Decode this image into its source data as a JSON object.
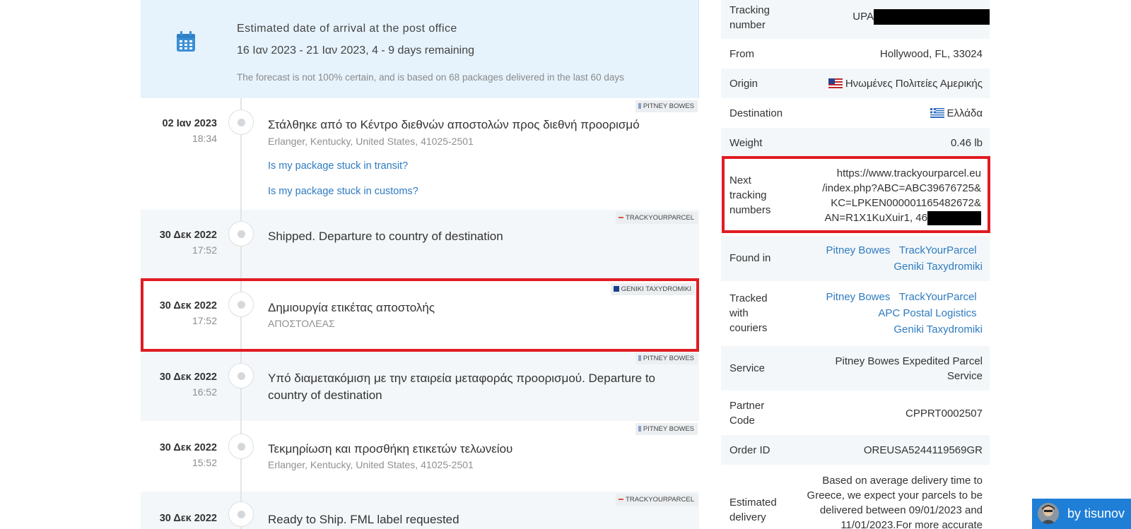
{
  "eta": {
    "title": "Estimated date of arrival at the post office",
    "range": "16 Ιαν 2023 - 21 Ιαν 2023, 4 - 9 days remaining",
    "note": "The forecast is not 100% certain, and is based on 68 packages delivered in the last 60 days"
  },
  "events": [
    {
      "date": "02 Ιαν 2023",
      "time": "18:34",
      "title": "Στάλθηκε από το Κέντρο διεθνών αποστολών προς διεθνή προορισμό",
      "location": "Erlanger, Kentucky, United States, 41025-2501",
      "courier": "PITNEY BOWES",
      "links": [
        "Is my package stuck in transit?",
        "Is my package stuck in customs?"
      ]
    },
    {
      "date": "30 Δεκ 2022",
      "time": "17:52",
      "title": "Shipped. Departure to country of destination",
      "location": "",
      "courier": "TRACKYOURPARCEL"
    },
    {
      "date": "30 Δεκ 2022",
      "time": "17:52",
      "title": "Δημιουργία ετικέτας αποστολής",
      "location": "ΑΠΟΣΤΟΛΕΑΣ",
      "courier": "GENIKI TAXYDROMIKI"
    },
    {
      "date": "30 Δεκ 2022",
      "time": "16:52",
      "title": "Υπό διαμετακόμιση με την εταιρεία μεταφοράς προορισμού. Departure to country of destination",
      "location": "",
      "courier": "PITNEY BOWES"
    },
    {
      "date": "30 Δεκ 2022",
      "time": "15:52",
      "title": "Τεκμηρίωση και προσθήκη ετικετών τελωνείου",
      "location": "Erlanger, Kentucky, United States, 41025-2501",
      "courier": "PITNEY BOWES"
    },
    {
      "date": "30 Δεκ 2022",
      "time": "",
      "title": "Ready to Ship. FML label requested",
      "location": "",
      "courier": "TRACKYOURPARCEL"
    }
  ],
  "info": {
    "tracking_number_label": [
      "Tracking",
      "number"
    ],
    "tracking_number_value": "UPA",
    "from_label": "From",
    "from_value": "Hollywood, FL, 33024",
    "origin_label": "Origin",
    "origin_value": "Ηνωμένες Πολιτείες Αμερικής",
    "destination_label": "Destination",
    "destination_value": "Ελλάδα",
    "weight_label": "Weight",
    "weight_value": "0.46 lb",
    "next_label": [
      "Next",
      "tracking",
      "numbers"
    ],
    "next_value": [
      "https://www.trackyourparcel.eu",
      "/index.php?ABC=ABC39676725&",
      "KC=LPKEN000001165482672&",
      "AN=R1X1KuXuir1, 46"
    ],
    "found_label": "Found in",
    "found_links": [
      "Pitney Bowes",
      "TrackYourParcel",
      "Geniki Taxydromiki"
    ],
    "tracked_label": [
      "Tracked",
      "with",
      "couriers"
    ],
    "tracked_links": [
      "Pitney Bowes",
      "TrackYourParcel",
      "APC Postal Logistics",
      "Geniki Taxydromiki"
    ],
    "service_label": "Service",
    "service_value": [
      "Pitney Bowes Expedited Parcel",
      "Service"
    ],
    "partner_label": [
      "Partner",
      "Code"
    ],
    "partner_value": "CPPRT0002507",
    "order_label": "Order ID",
    "order_value": "OREUSA5244119569GR",
    "est_label": [
      "Estimated",
      "delivery"
    ],
    "est_value": [
      "Based on average delivery time to",
      "Greece, we expect your parcels to be",
      "delivered between 09/01/2023 and",
      "11/01/2023.For more accurate"
    ]
  },
  "byline": "by tisunov",
  "colors": {
    "accent": "#2e7bc0",
    "highlight": "#e11b22",
    "eta_bg": "#e6f3fd",
    "byline_bg": "#1f7ed6"
  }
}
